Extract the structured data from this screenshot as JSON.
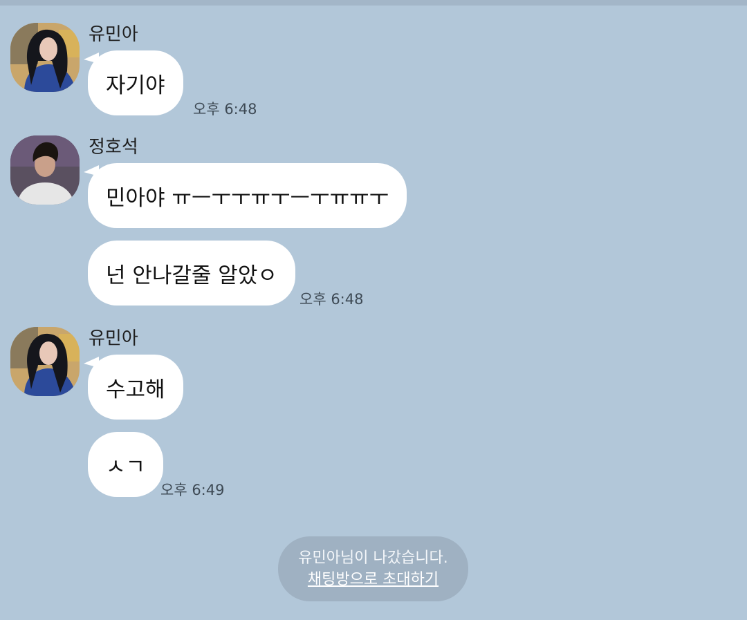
{
  "messages": [
    {
      "sender": "유민아",
      "bubbles": [
        "자기야"
      ],
      "time": "오후 6:48"
    },
    {
      "sender": "정호석",
      "bubbles": [
        "민아야 ㅠㅡㅜㅜㅠㅜㅡㅜㅠㅠㅜ",
        "넌 안나갈줄 알았ㅇ"
      ],
      "time": "오후 6:48"
    },
    {
      "sender": "유민아",
      "bubbles": [
        "수고해",
        "ㅅㄱ"
      ],
      "time": "오후 6:49"
    }
  ],
  "notice": {
    "text": "유민아님이 나갔습니다.",
    "invite_label": "채팅방으로 초대하기"
  },
  "colors": {
    "background": "#b2c7d9",
    "bubble": "#ffffff",
    "notice": "#9fb1c2"
  }
}
